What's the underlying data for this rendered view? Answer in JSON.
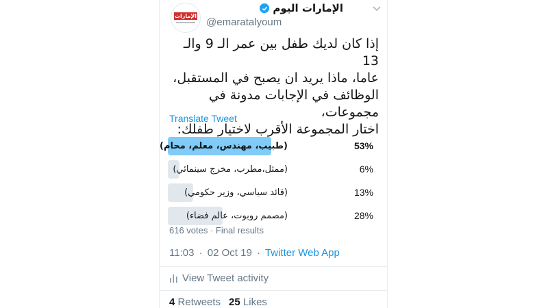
{
  "account": {
    "name": "الإمارات اليوم",
    "handle": "@emaratalyoum",
    "avatar_text": "الإمارات اليوم"
  },
  "tweet": {
    "text_lines": [
      "إذا كان لديك طفل بين عمر الـ 9 والـ 13",
      "عاما، ماذا يريد ان يصبح في المستقبل،",
      "الوظائف في الإجابات مدونة في مجموعات،",
      "اختار المجموعة الأقرب لاختيار طفلك:"
    ],
    "translate_label": "Translate Tweet"
  },
  "poll": {
    "options": [
      {
        "label": "(طبيب، مهندس، معلم، محام)",
        "percent_text": "53%",
        "percent": 53,
        "winner": true
      },
      {
        "label": "(ممثل،مطرب، مخرج سينمائي)",
        "percent_text": "6%",
        "percent": 6,
        "winner": false
      },
      {
        "label": "(قائد سياسي، وزير حكومي)",
        "percent_text": "13%",
        "percent": 13,
        "winner": false
      },
      {
        "label": "(مصمم روبوت، عالم فضاء)",
        "percent_text": "28%",
        "percent": 28,
        "winner": false
      }
    ],
    "meta": "616 votes · Final results"
  },
  "timestamp": {
    "time": "11:03",
    "date": "02 Oct 19",
    "source": "Twitter Web App"
  },
  "activity_label": "View Tweet activity",
  "stats": {
    "retweets_count": "4",
    "retweets_label": "Retweets",
    "likes_count": "25",
    "likes_label": "Likes"
  },
  "colors": {
    "accent": "#1da1f2",
    "link": "#1b95e0",
    "winner_bar": "#80cbf7",
    "other_bar": "#e1e8ed",
    "muted_text": "#657786"
  },
  "icons": [
    "verified-badge-icon",
    "chevron-down-icon",
    "activity-bars-icon"
  ]
}
